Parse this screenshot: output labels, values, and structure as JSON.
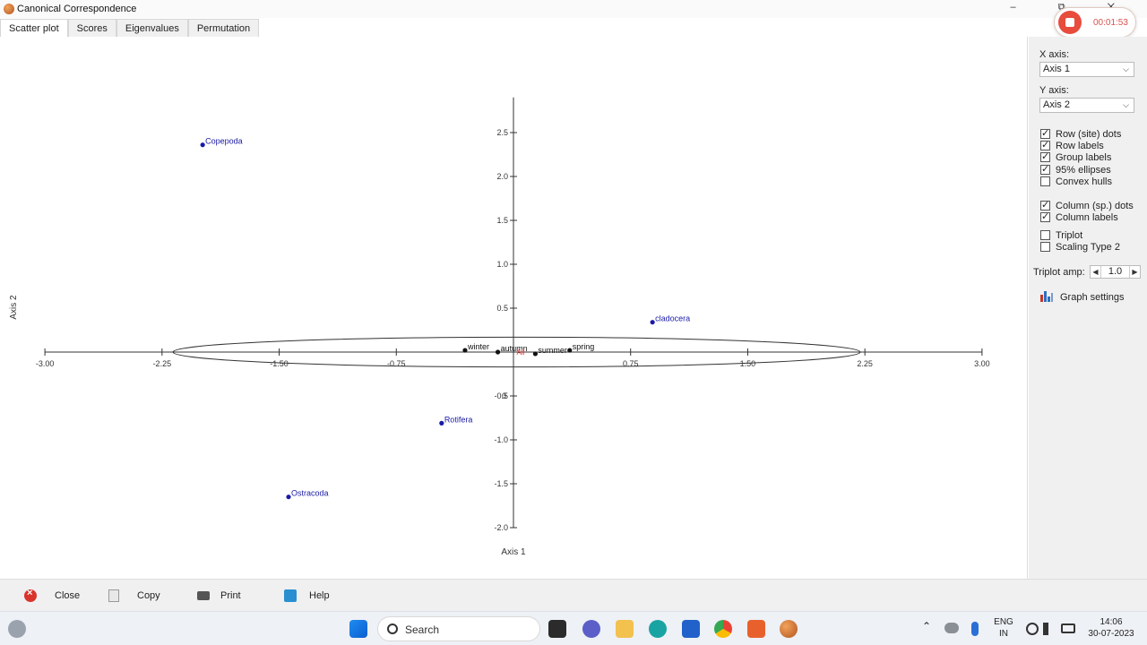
{
  "window": {
    "title": "Canonical Correspondence",
    "controls": "– ⧉ ✕"
  },
  "recorder": {
    "time": "00:01:53"
  },
  "tabs": [
    {
      "label": "Scatter plot",
      "active": true
    },
    {
      "label": "Scores",
      "active": false
    },
    {
      "label": "Eigenvalues",
      "active": false
    },
    {
      "label": "Permutation",
      "active": false
    }
  ],
  "chart_data": {
    "type": "scatter",
    "xlabel": "Axis 1",
    "ylabel": "Axis 2",
    "xlim": [
      -3.0,
      3.0
    ],
    "ylim": [
      -2.0,
      2.9
    ],
    "x_ticks": [
      -3.0,
      -2.25,
      -1.5,
      -0.75,
      0,
      0.75,
      1.5,
      2.25,
      3.0
    ],
    "x_tick_labels": [
      "-3.00",
      "-2.25",
      "-1.50",
      "-0.75",
      "0",
      "0.75",
      "1.50",
      "2.25",
      "3.00"
    ],
    "y_ticks": [
      -2.0,
      -1.5,
      -1.0,
      -0.5,
      0,
      0.5,
      1.0,
      1.5,
      2.0,
      2.5
    ],
    "y_tick_labels": [
      "-2.0",
      "-1.5",
      "-1.0",
      "-0.5",
      "0",
      "0.5",
      "1.0",
      "1.5",
      "2.0",
      "2.5"
    ],
    "series": [
      {
        "color": "#1a1aa6",
        "points": [
          {
            "label": "Copepoda",
            "x": -1.99,
            "y": 2.36
          },
          {
            "label": "cladocera",
            "x": 0.89,
            "y": 0.34
          },
          {
            "label": "Rotifera",
            "x": -0.46,
            "y": -0.81
          },
          {
            "label": "Ostracoda",
            "x": -1.44,
            "y": -1.65
          }
        ]
      },
      {
        "color": "#111111",
        "points": [
          {
            "label": "winter",
            "x": -0.31,
            "y": 0.02
          },
          {
            "label": "autumn",
            "x": -0.1,
            "y": 0.0
          },
          {
            "label": "summer",
            "x": 0.14,
            "y": -0.02
          },
          {
            "label": "spring",
            "x": 0.36,
            "y": 0.02
          }
        ]
      }
    ],
    "group_label": {
      "text": "All",
      "x": 0.02,
      "y": 0.0,
      "color": "#e03030"
    },
    "ellipse": {
      "cx": 0.02,
      "cy": 0.0,
      "rx": 2.2,
      "ry": 0.17
    }
  },
  "sidebar": {
    "x_axis_label": "X axis:",
    "x_axis_value": "Axis 1",
    "y_axis_label": "Y axis:",
    "y_axis_value": "Axis 2",
    "checkboxes": [
      {
        "label": "Row (site) dots",
        "checked": true
      },
      {
        "label": "Row labels",
        "checked": true
      },
      {
        "label": "Group labels",
        "checked": true
      },
      {
        "label": "95% ellipses",
        "checked": true
      },
      {
        "label": "Convex hulls",
        "checked": false
      },
      {
        "label": "Column (sp.) dots",
        "checked": true
      },
      {
        "label": "Column labels",
        "checked": true
      },
      {
        "label": "Triplot",
        "checked": false
      },
      {
        "label": "Scaling Type 2",
        "checked": false
      }
    ],
    "triplot_amp_label": "Triplot amp:",
    "triplot_amp_value": "1.0",
    "graph_settings_label": "Graph settings"
  },
  "bottom_buttons": {
    "close": "Close",
    "copy": "Copy",
    "print": "Print",
    "help": "Help"
  },
  "taskbar": {
    "search_placeholder": "Search",
    "lang_line1": "ENG",
    "lang_line2": "IN",
    "time": "14:06",
    "date": "30-07-2023"
  }
}
